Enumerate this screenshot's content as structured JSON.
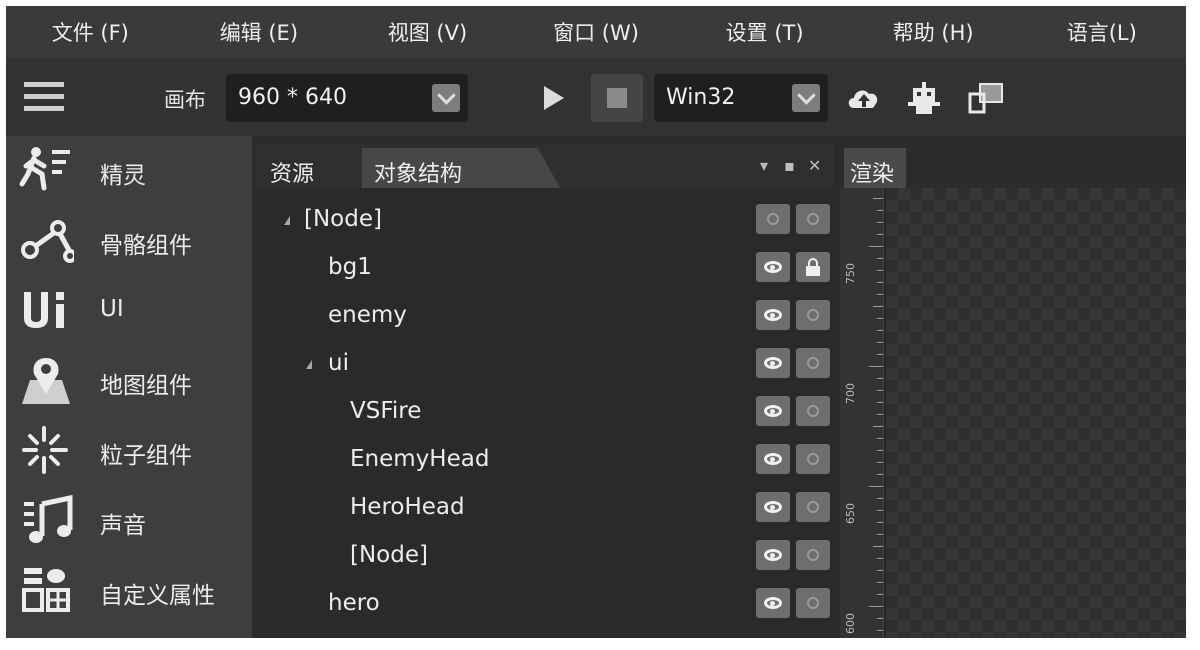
{
  "menu": [
    "文件 (F)",
    "编辑 (E)",
    "视图 (V)",
    "窗口 (W)",
    "设置 (T)",
    "帮助 (H)",
    "语言(L)"
  ],
  "toolbar": {
    "canvas_label": "画布",
    "canvas_size": "960 * 640",
    "platform": "Win32"
  },
  "sidebar": {
    "items": [
      {
        "label": "精灵",
        "icon": "sprite-runner-icon"
      },
      {
        "label": "骨骼组件",
        "icon": "skeleton-bone-icon"
      },
      {
        "label": "UI",
        "icon": "ui-icon"
      },
      {
        "label": "地图组件",
        "icon": "map-pin-icon"
      },
      {
        "label": "粒子组件",
        "icon": "particle-icon"
      },
      {
        "label": "声音",
        "icon": "music-note-icon"
      },
      {
        "label": "自定义属性",
        "icon": "custom-property-icon"
      }
    ]
  },
  "hierarchy": {
    "tabs": [
      "资源",
      "对象结构"
    ],
    "nodes": [
      {
        "label": "[Node]",
        "expanded": true,
        "visible_toggle": false,
        "locked": false
      },
      {
        "label": "bg1",
        "expanded": false,
        "visible_toggle": true,
        "locked": true
      },
      {
        "label": "enemy",
        "expanded": false,
        "visible_toggle": true,
        "locked": false
      },
      {
        "label": "ui",
        "expanded": true,
        "visible_toggle": true,
        "locked": false
      },
      {
        "label": "VSFire",
        "expanded": false,
        "visible_toggle": true,
        "locked": false
      },
      {
        "label": "EnemyHead",
        "expanded": false,
        "visible_toggle": true,
        "locked": false
      },
      {
        "label": "HeroHead",
        "expanded": false,
        "visible_toggle": true,
        "locked": false
      },
      {
        "label": "[Node]",
        "expanded": false,
        "visible_toggle": true,
        "locked": false
      },
      {
        "label": "hero",
        "expanded": false,
        "visible_toggle": true,
        "locked": false
      }
    ]
  },
  "render": {
    "tab": "渲染",
    "ruler_labels": [
      "750",
      "700",
      "650",
      "600"
    ]
  }
}
